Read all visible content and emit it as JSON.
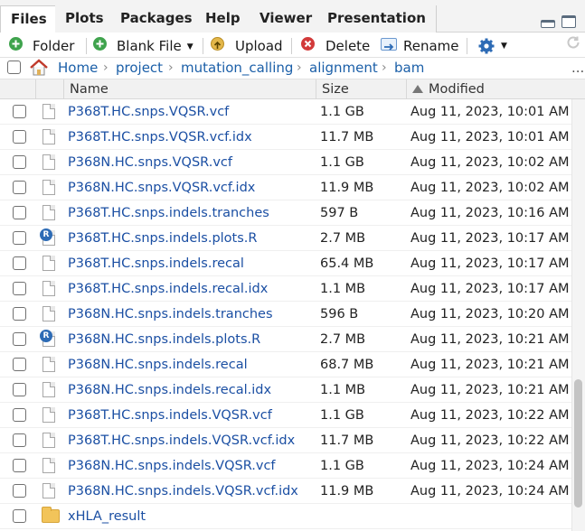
{
  "tabs": [
    {
      "label": "Files",
      "active": true
    },
    {
      "label": "Plots"
    },
    {
      "label": "Packages"
    },
    {
      "label": "Help"
    },
    {
      "label": "Viewer"
    },
    {
      "label": "Presentation"
    }
  ],
  "toolbar": {
    "folder": "Folder",
    "blank_file": "Blank File",
    "upload": "Upload",
    "delete": "Delete",
    "rename": "Rename",
    "gear_icon": "gear-icon",
    "refresh_icon": "refresh-icon"
  },
  "breadcrumb": {
    "home": "Home",
    "parts": [
      "project",
      "mutation_calling",
      "alignment",
      "bam"
    ],
    "more": "..."
  },
  "columns": {
    "name": "Name",
    "size": "Size",
    "modified": "Modified"
  },
  "files": [
    {
      "name": "P368T.HC.snps.VQSR.vcf",
      "size": "1.1 GB",
      "modified": "Aug 11, 2023, 10:01 AM",
      "type": "file"
    },
    {
      "name": "P368T.HC.snps.VQSR.vcf.idx",
      "size": "11.7 MB",
      "modified": "Aug 11, 2023, 10:01 AM",
      "type": "file"
    },
    {
      "name": "P368N.HC.snps.VQSR.vcf",
      "size": "1.1 GB",
      "modified": "Aug 11, 2023, 10:02 AM",
      "type": "file"
    },
    {
      "name": "P368N.HC.snps.VQSR.vcf.idx",
      "size": "11.9 MB",
      "modified": "Aug 11, 2023, 10:02 AM",
      "type": "file"
    },
    {
      "name": "P368T.HC.snps.indels.tranches",
      "size": "597 B",
      "modified": "Aug 11, 2023, 10:16 AM",
      "type": "file"
    },
    {
      "name": "P368T.HC.snps.indels.plots.R",
      "size": "2.7 MB",
      "modified": "Aug 11, 2023, 10:17 AM",
      "type": "r"
    },
    {
      "name": "P368T.HC.snps.indels.recal",
      "size": "65.4 MB",
      "modified": "Aug 11, 2023, 10:17 AM",
      "type": "file"
    },
    {
      "name": "P368T.HC.snps.indels.recal.idx",
      "size": "1.1 MB",
      "modified": "Aug 11, 2023, 10:17 AM",
      "type": "file"
    },
    {
      "name": "P368N.HC.snps.indels.tranches",
      "size": "596 B",
      "modified": "Aug 11, 2023, 10:20 AM",
      "type": "file"
    },
    {
      "name": "P368N.HC.snps.indels.plots.R",
      "size": "2.7 MB",
      "modified": "Aug 11, 2023, 10:21 AM",
      "type": "r"
    },
    {
      "name": "P368N.HC.snps.indels.recal",
      "size": "68.7 MB",
      "modified": "Aug 11, 2023, 10:21 AM",
      "type": "file"
    },
    {
      "name": "P368N.HC.snps.indels.recal.idx",
      "size": "1.1 MB",
      "modified": "Aug 11, 2023, 10:21 AM",
      "type": "file"
    },
    {
      "name": "P368T.HC.snps.indels.VQSR.vcf",
      "size": "1.1 GB",
      "modified": "Aug 11, 2023, 10:22 AM",
      "type": "file"
    },
    {
      "name": "P368T.HC.snps.indels.VQSR.vcf.idx",
      "size": "11.7 MB",
      "modified": "Aug 11, 2023, 10:22 AM",
      "type": "file"
    },
    {
      "name": "P368N.HC.snps.indels.VQSR.vcf",
      "size": "1.1 GB",
      "modified": "Aug 11, 2023, 10:24 AM",
      "type": "file"
    },
    {
      "name": "P368N.HC.snps.indels.VQSR.vcf.idx",
      "size": "11.9 MB",
      "modified": "Aug 11, 2023, 10:24 AM",
      "type": "file"
    },
    {
      "name": "xHLA_result",
      "size": "",
      "modified": "",
      "type": "folder"
    }
  ],
  "colors": {
    "link": "#1b4fa3",
    "accent": "#2d6bb5"
  }
}
